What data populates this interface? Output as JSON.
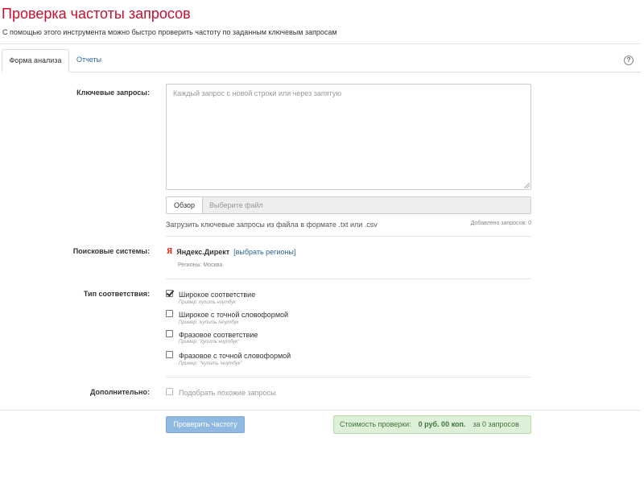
{
  "header": {
    "title": "Проверка частоты запросов",
    "subtitle": "С помощью этого инструмента можно быстро проверить частоту по заданным ключевым запросам"
  },
  "tabs": [
    {
      "label": "Форма анализа",
      "active": true
    },
    {
      "label": "Отчеты",
      "active": false
    }
  ],
  "help_icon": {
    "glyph": "?",
    "name": "help-icon"
  },
  "form": {
    "keywords": {
      "label": "Ключевые запросы:",
      "placeholder": "Каждый запрос с новой строки или через запятую",
      "value": ""
    },
    "file": {
      "browse_label": "Обзор",
      "placeholder": "Выберите файл",
      "hint": "Загрузить ключевые запросы из файла в формате .txt или .csv",
      "added_count": "Добавлено запросов: 0"
    },
    "search_engines": {
      "label": "Поисковые системы:",
      "icon_glyph": "Я",
      "engine_name": "Яндекс.Директ",
      "select_regions_link": "[выбрать регионы]",
      "regions_text": "Регионы: Москва"
    },
    "match_type": {
      "label": "Тип соответствия:",
      "options": [
        {
          "label": "Широкое соответствие",
          "example": "Пример: купить ноутбук",
          "checked": true
        },
        {
          "label": "Широкое с точной словоформой",
          "example": "Пример: !купить !ноутбук",
          "checked": false
        },
        {
          "label": "Фразовое соответствие",
          "example": "Пример: \"купить ноутбук\"",
          "checked": false
        },
        {
          "label": "Фразовое с точной словоформой",
          "example": "Пример: \"!купить !ноутбук\"",
          "checked": false
        }
      ]
    },
    "additional": {
      "label": "Дополнительно:",
      "option_label": "Подобрать похожие запросы",
      "checked": false
    }
  },
  "footer": {
    "submit_label": "Проверить частоту",
    "cost_label": "Стоимость проверки:",
    "cost_amount": "0 руб. 00 коп.",
    "cost_count": "за 0 запросов"
  },
  "colors": {
    "title_red": "#c8102e",
    "link_blue": "#2a6496",
    "submit_blue": "#8fb9e0",
    "cost_green_bg": "#dff0d8",
    "cost_green_text": "#3c763d"
  }
}
